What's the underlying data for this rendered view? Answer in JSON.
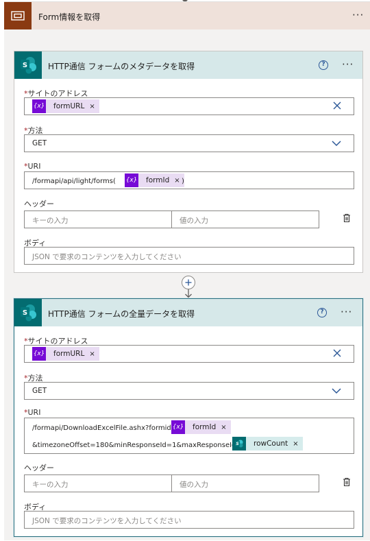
{
  "scope": {
    "title": "Form情報を取得",
    "more": "···"
  },
  "action1": {
    "title": "HTTP通信 フォームのメタデータを取得",
    "help": "?",
    "more": "···",
    "site": {
      "label": "サイトのアドレス",
      "token": "formURL",
      "token_icon": "{x}"
    },
    "method": {
      "label": "方法",
      "value": "GET"
    },
    "uri": {
      "label": "URI",
      "prefix": "/formapi/api/light/forms(",
      "token": "formId",
      "token_icon": "{x}",
      "suffix": ")"
    },
    "headers": {
      "label": "ヘッダー",
      "key_placeholder": "キーの入力",
      "value_placeholder": "値の入力"
    },
    "body": {
      "label": "ボディ",
      "placeholder": "JSON で要求のコンテンツを入力してください"
    }
  },
  "action2": {
    "title": "HTTP通信 フォームの全量データを取得",
    "help": "?",
    "more": "···",
    "site": {
      "label": "サイトのアドレス",
      "token": "formURL",
      "token_icon": "{x}"
    },
    "method": {
      "label": "方法",
      "value": "GET"
    },
    "uri": {
      "label": "URI",
      "line1_prefix": "/formapi/DownloadExcelFile.ashx?formid=",
      "line1_token": "formId",
      "line1_token_icon": "{x}",
      "line2_prefix": "&timezoneOffset=180&minResponseId=1&maxResponseId=",
      "line2_token": "rowCount"
    },
    "headers": {
      "label": "ヘッダー",
      "key_placeholder": "キーの入力",
      "value_placeholder": "値の入力"
    },
    "body": {
      "label": "ボディ",
      "placeholder": "JSON で要求のコンテンツを入力してください"
    }
  },
  "required_mark": "*",
  "remove_mark": "×",
  "colors": {
    "scope_accent": "#8a3a12",
    "scope_header": "#efe1da",
    "sharepoint": "#036c70",
    "card_header": "#d6e8e9",
    "variable_token": "#770bd6",
    "required": "#a4262c",
    "link": "#2b5797"
  },
  "icons": {
    "scope": "scope-icon",
    "connector": "sharepoint-icon",
    "variable": "variable-icon",
    "clear": "close-icon",
    "dropdown": "chevron-down-icon",
    "delete": "trash-icon",
    "add_step": "plus-icon"
  }
}
